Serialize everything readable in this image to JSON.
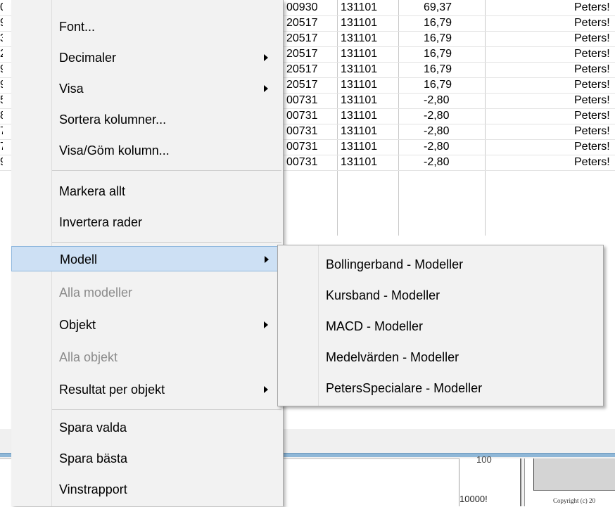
{
  "grid": {
    "rows": [
      {
        "a": "00930",
        "b": "131101",
        "c": "69,37",
        "d": "Peters!"
      },
      {
        "a": "20517",
        "b": "131101",
        "c": "16,79",
        "d": "Peters!"
      },
      {
        "a": "20517",
        "b": "131101",
        "c": "16,79",
        "d": "Peters!"
      },
      {
        "a": "20517",
        "b": "131101",
        "c": "16,79",
        "d": "Peters!"
      },
      {
        "a": "20517",
        "b": "131101",
        "c": "16,79",
        "d": "Peters!"
      },
      {
        "a": "20517",
        "b": "131101",
        "c": "16,79",
        "d": "Peters!"
      },
      {
        "a": "00731",
        "b": "131101",
        "c": "-2,80",
        "d": "Peters!"
      },
      {
        "a": "00731",
        "b": "131101",
        "c": "-2,80",
        "d": "Peters!"
      },
      {
        "a": "00731",
        "b": "131101",
        "c": "-2,80",
        "d": "Peters!"
      },
      {
        "a": "00731",
        "b": "131101",
        "c": "-2,80",
        "d": "Peters!"
      },
      {
        "a": "00731",
        "b": "131101",
        "c": "-2,80",
        "d": "Peters!"
      }
    ],
    "edge_chars": [
      "0",
      "9",
      "3",
      "2",
      "9",
      "9",
      "5",
      "8",
      "7",
      "7",
      "9"
    ]
  },
  "lower": {
    "tick_label": "100",
    "number": "10000!",
    "copyright": "Copyright (c) 20"
  },
  "menu": {
    "items": [
      {
        "label": "Font...",
        "state": "normal",
        "submenu": false
      },
      {
        "label": "Decimaler",
        "state": "normal",
        "submenu": true
      },
      {
        "label": "Visa",
        "state": "normal",
        "submenu": true
      },
      {
        "label": "Sortera kolumner...",
        "state": "normal",
        "submenu": false
      },
      {
        "label": "Visa/Göm kolumn...",
        "state": "normal",
        "submenu": false
      },
      {
        "label": "Markera allt",
        "state": "normal",
        "submenu": false
      },
      {
        "label": "Invertera rader",
        "state": "normal",
        "submenu": false
      },
      {
        "label": "Modell",
        "state": "highlighted",
        "submenu": true
      },
      {
        "label": "Alla modeller",
        "state": "disabled",
        "submenu": false
      },
      {
        "label": "Objekt",
        "state": "normal",
        "submenu": true
      },
      {
        "label": "Alla objekt",
        "state": "disabled",
        "submenu": false
      },
      {
        "label": "Resultat per objekt",
        "state": "normal",
        "submenu": true
      },
      {
        "label": "Spara valda",
        "state": "normal",
        "submenu": false
      },
      {
        "label": "Spara bästa",
        "state": "normal",
        "submenu": false
      },
      {
        "label": "Vinstrapport",
        "state": "normal",
        "submenu": false
      }
    ],
    "submenu_arrow_icon": "chevron-right-icon"
  },
  "submenu": {
    "items": [
      {
        "label": "Bollingerband - Modeller"
      },
      {
        "label": "Kursband - Modeller"
      },
      {
        "label": "MACD - Modeller"
      },
      {
        "label": "Medelvärden - Modeller"
      },
      {
        "label": "PetersSpecialare - Modeller"
      }
    ]
  },
  "colors": {
    "highlight_bg": "#cde0f4",
    "highlight_border": "#90b8de",
    "menu_bg": "#f2f2f2",
    "disabled_text": "#8b8b8b",
    "blue_divider": "#8fb7d7"
  }
}
